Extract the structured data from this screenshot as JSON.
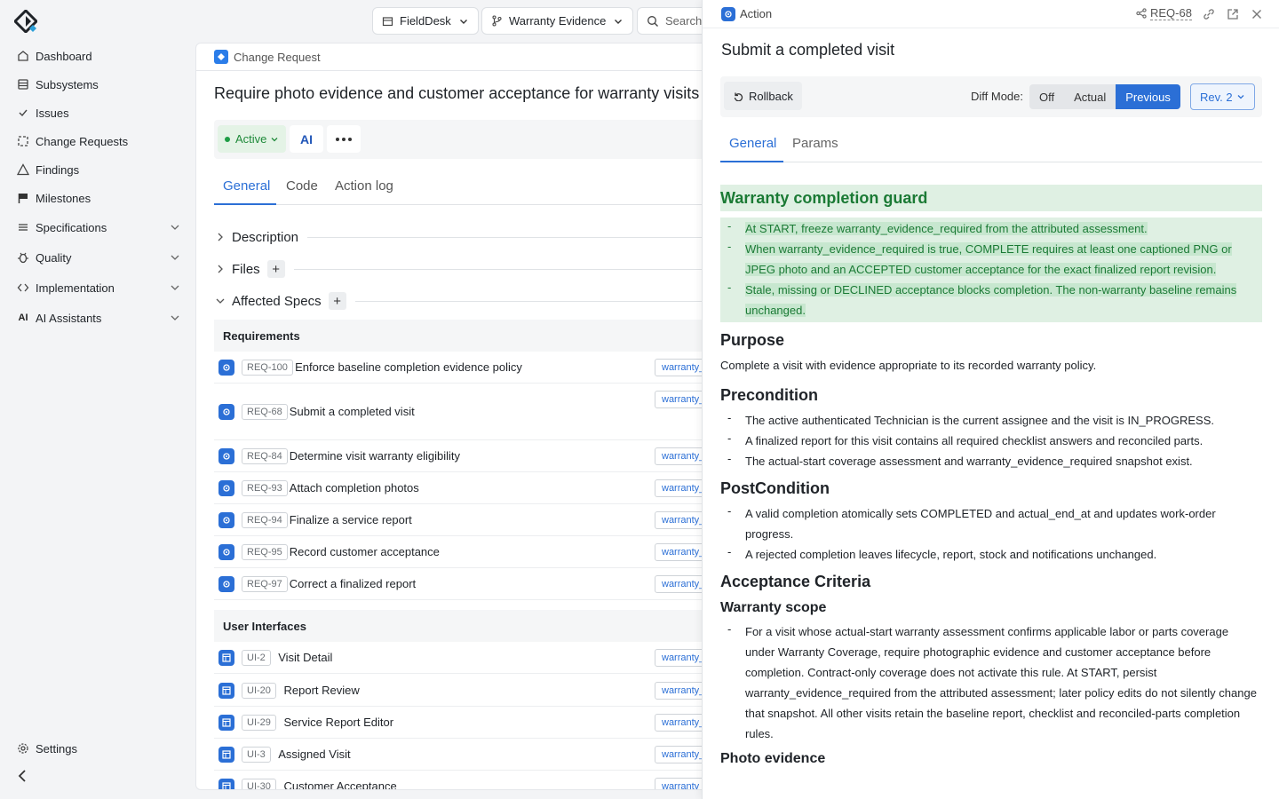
{
  "sidebar": {
    "items": [
      {
        "label": "Dashboard",
        "icon": "dashboard-icon"
      },
      {
        "label": "Subsystems",
        "icon": "database-icon"
      },
      {
        "label": "Issues",
        "icon": "check-icon"
      },
      {
        "label": "Change Requests",
        "icon": "selection-icon"
      },
      {
        "label": "Findings",
        "icon": "warning-icon"
      },
      {
        "label": "Milestones",
        "icon": "flag-icon"
      },
      {
        "label": "Specifications",
        "icon": "list-icon"
      },
      {
        "label": "Quality",
        "icon": "bug-icon"
      },
      {
        "label": "Implementation",
        "icon": "code-icon"
      },
      {
        "label": "AI Assistants",
        "icon": "ai-icon"
      }
    ],
    "settings_label": "Settings"
  },
  "topbar": {
    "project": "FieldDesk",
    "branch": "Warranty Evidence",
    "search_placeholder": "Search"
  },
  "main": {
    "breadcrumb": "Change Request",
    "title": "Require photo evidence and customer acceptance for warranty visits",
    "status": "Active",
    "ai_label": "AI",
    "tabs": [
      "General",
      "Code",
      "Action log"
    ],
    "sections": {
      "description": "Description",
      "files": "Files",
      "affected_specs": "Affected Specs"
    },
    "requirements_heading": "Requirements",
    "requirements": [
      {
        "id": "REQ-100",
        "name": "Enforce baseline completion evidence policy",
        "tag": "warranty_evidence"
      },
      {
        "id": "REQ-68",
        "name": "Submit a completed visit",
        "tag": "warranty_evidence"
      },
      {
        "id": "REQ-84",
        "name": "Determine visit warranty eligibility",
        "tag": "warranty_evidence"
      },
      {
        "id": "REQ-93",
        "name": "Attach completion photos",
        "tag": "warranty_evidence"
      },
      {
        "id": "REQ-94",
        "name": "Finalize a service report",
        "tag": "warranty_evidence"
      },
      {
        "id": "REQ-95",
        "name": "Record customer acceptance",
        "tag": "warranty_evidence"
      },
      {
        "id": "REQ-97",
        "name": "Correct a finalized report",
        "tag": "warranty_evidence"
      }
    ],
    "ui_heading": "User Interfaces",
    "interfaces": [
      {
        "id": "UI-2",
        "name": "Visit Detail",
        "tag": "warranty_evidence"
      },
      {
        "id": "UI-20",
        "name": "Report Review",
        "tag": "warranty_evidence"
      },
      {
        "id": "UI-29",
        "name": "Service Report Editor",
        "tag": "warranty_evidence"
      },
      {
        "id": "UI-3",
        "name": "Assigned Visit",
        "tag": "warranty_evidence"
      },
      {
        "id": "UI-30",
        "name": "Customer Acceptance",
        "tag": "warranty_evidence"
      }
    ]
  },
  "drawer": {
    "type_label": "Action",
    "ref": "REQ-68",
    "title": "Submit a completed visit",
    "rollback": "Rollback",
    "diff_mode_label": "Diff Mode:",
    "diff_modes": [
      "Off",
      "Actual",
      "Previous"
    ],
    "diff_selected": "Previous",
    "revision": "Rev. 2",
    "tabs": [
      "General",
      "Params"
    ],
    "guard_heading": "Warranty completion guard",
    "guard_items": [
      "At START, freeze warranty_evidence_required from the attributed assessment.",
      "When warranty_evidence_required is true, COMPLETE requires at least one captioned PNG or JPEG photo and an ACCEPTED customer acceptance for the exact finalized report revision.",
      "Stale, missing or DECLINED acceptance blocks completion. The non-warranty baseline remains unchanged."
    ],
    "purpose_heading": "Purpose",
    "purpose_text": "Complete a visit with evidence appropriate to its recorded warranty policy.",
    "precondition_heading": "Precondition",
    "preconditions": [
      "The active authenticated Technician is the current assignee and the visit is IN_PROGRESS.",
      "A finalized report for this visit contains all required checklist answers and reconciled parts.",
      "The actual-start coverage assessment and warranty_evidence_required snapshot exist."
    ],
    "postcondition_heading": "PostCondition",
    "postconditions": [
      "A valid completion atomically sets COMPLETED and actual_end_at and updates work-order progress.",
      "A rejected completion leaves lifecycle, report, stock and notifications unchanged."
    ],
    "acceptance_heading": "Acceptance Criteria",
    "warranty_scope_heading": "Warranty scope",
    "warranty_scope_items": [
      "For a visit whose actual-start warranty assessment confirms applicable labor or parts coverage under Warranty Coverage, require photographic evidence and customer acceptance before completion. Contract-only coverage does not activate this rule. At START, persist warranty_evidence_required from the attributed assessment; later policy edits do not silently change that snapshot. All other visits retain the baseline report, checklist and reconciled-parts completion rules."
    ],
    "photo_evidence_heading": "Photo evidence"
  }
}
